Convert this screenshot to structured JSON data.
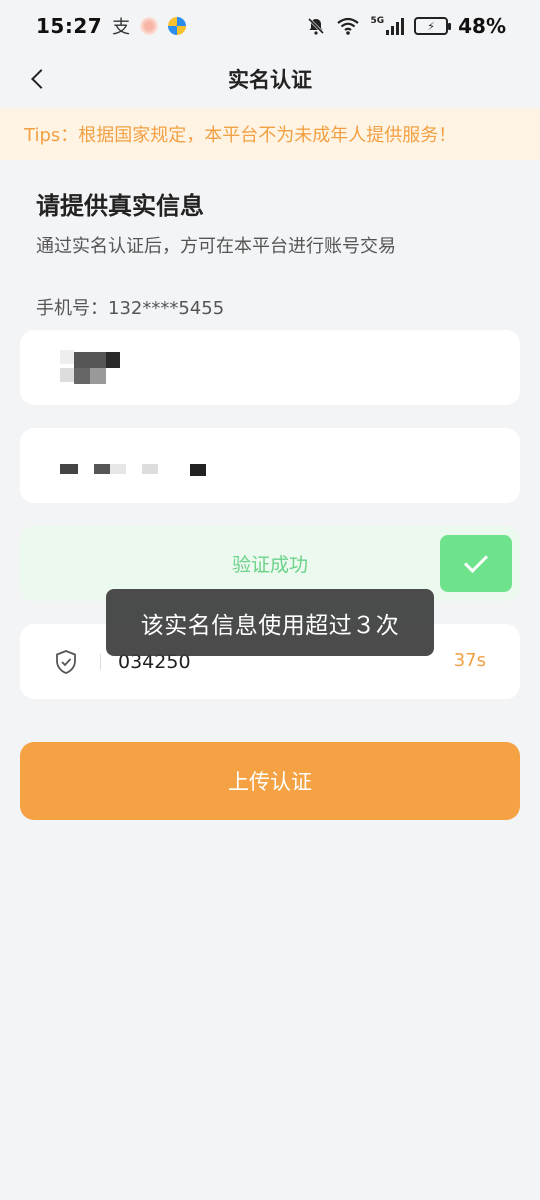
{
  "status_bar": {
    "time": "15:27",
    "battery": "48%",
    "network": "5G"
  },
  "nav": {
    "title": "实名认证"
  },
  "tips": {
    "text": "Tips：根据国家规定，本平台不为未成年人提供服务！"
  },
  "form": {
    "title": "请提供真实信息",
    "subtitle": "通过实名认证后，方可在本平台进行账号交易",
    "phone_label": "手机号：132****5455",
    "verify_text": "验证成功",
    "code_value": "034250",
    "countdown": "37s",
    "submit_label": "上传认证"
  },
  "toast": {
    "text": "该实名信息使用超过３次"
  },
  "colors": {
    "accent": "#f5a244",
    "tips_bg": "#fff4e3",
    "success": "#6ee38c",
    "success_bg": "#ecf9ee",
    "page_bg": "#f3f4f6"
  }
}
